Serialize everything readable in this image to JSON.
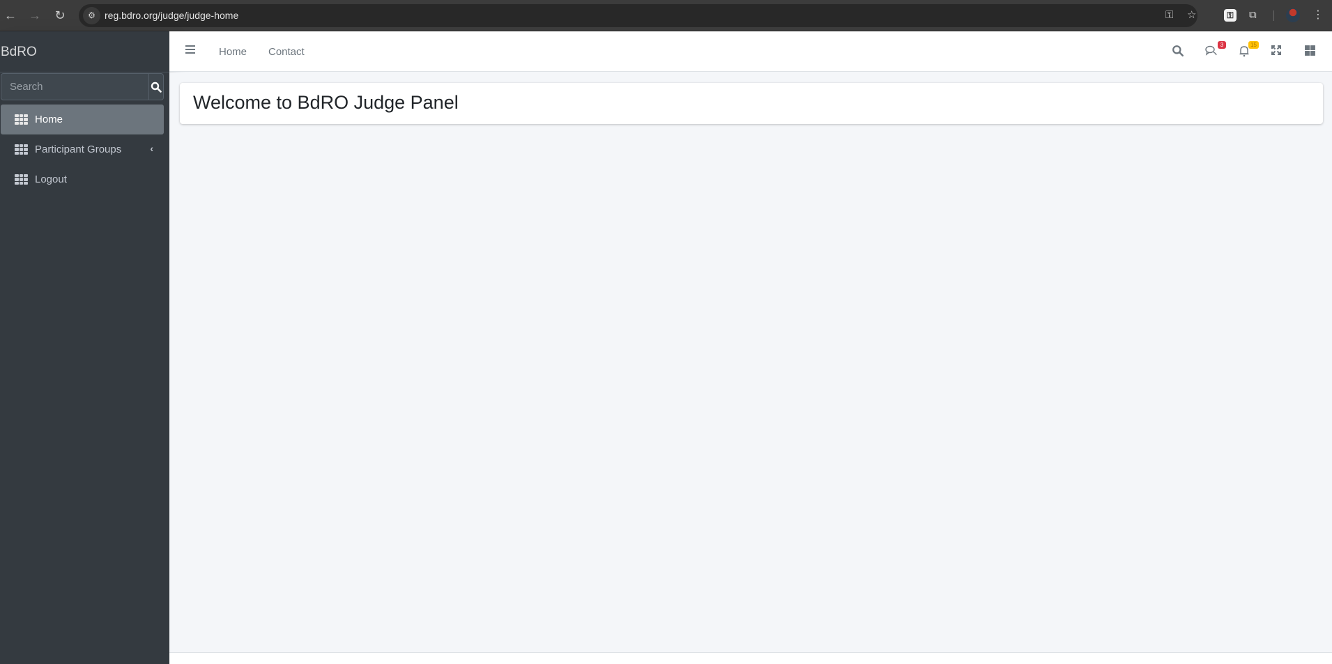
{
  "browser": {
    "url": "reg.bdro.org/judge/judge-home",
    "icons": [
      "back-icon",
      "forward-icon",
      "reload-icon",
      "site-info-icon",
      "password-key-icon",
      "bookmark-star-icon",
      "extension-key-icon",
      "extensions-puzzle-icon",
      "profile-avatar",
      "menu-kebab-icon"
    ]
  },
  "sidebar": {
    "brand": "BdRO",
    "search": {
      "placeholder": "Search",
      "value": ""
    },
    "items": [
      {
        "label": "Home",
        "icon": "grid-icon",
        "active": true
      },
      {
        "label": "Participant Groups",
        "icon": "grid-icon",
        "expandable": true
      },
      {
        "label": "Logout",
        "icon": "grid-icon"
      }
    ]
  },
  "navbar": {
    "links": [
      {
        "label": "Home"
      },
      {
        "label": "Contact"
      }
    ],
    "messages_badge": "3",
    "notifications_badge": "15"
  },
  "main": {
    "title": "Welcome to BdRO Judge Panel"
  },
  "colors": {
    "sidebar_bg": "#343a40",
    "active_item_bg": "#6c757d",
    "content_bg": "#f4f6f9",
    "badge_danger": "#dc3545",
    "badge_warning": "#ffc107"
  }
}
